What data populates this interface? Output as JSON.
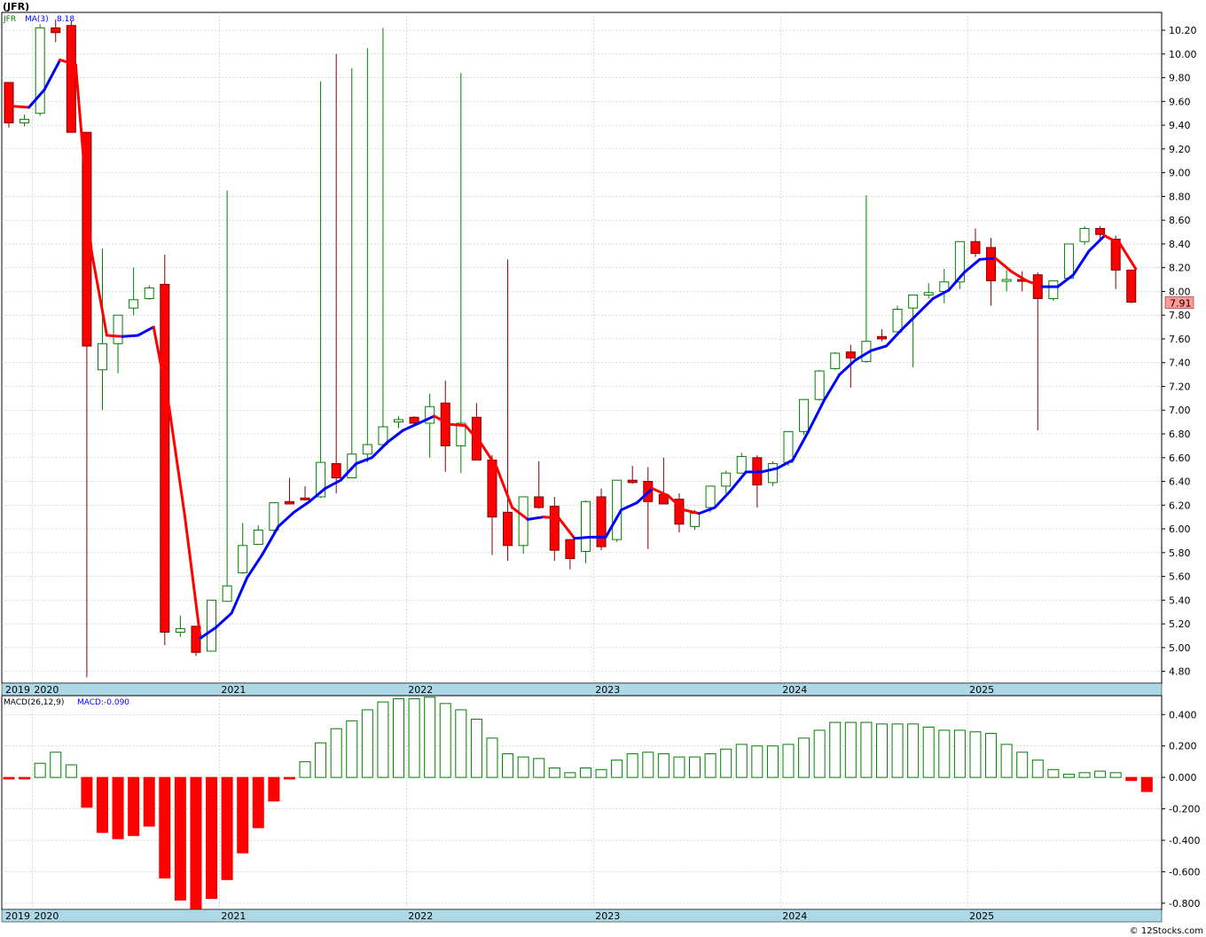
{
  "header": {
    "symbol": "(JFR)"
  },
  "footer": {
    "watermark": "© 12Stocks.com"
  },
  "colors": {
    "up": "#008000",
    "down": "#ff0000",
    "downStroke": "#800000",
    "ma_up": "#0000ff",
    "ma_down": "#ff0000",
    "grid": "#c0c0c0",
    "axisBand": "#add8e6",
    "lastPriceBg": "#ff9999"
  },
  "chart_data": [
    {
      "type": "candlestick",
      "title": "(JFR)",
      "legend": {
        "symbol": "JFR",
        "ma_label": "MA(3)",
        "ma_value": "8.18"
      },
      "frequency": "monthly",
      "start": "2019-11",
      "ylim": [
        4.7,
        10.35
      ],
      "y_ticks": [
        "10.20",
        "10.00",
        "9.80",
        "9.60",
        "9.40",
        "9.20",
        "9.00",
        "8.80",
        "8.60",
        "8.40",
        "8.20",
        "8.00",
        "7.80",
        "7.60",
        "7.40",
        "7.20",
        "7.00",
        "6.80",
        "6.60",
        "6.40",
        "6.20",
        "6.00",
        "5.80",
        "5.60",
        "5.40",
        "5.20",
        "5.00",
        "4.80"
      ],
      "x_tick_labels": [
        "2019",
        "2020",
        "2021",
        "2022",
        "2023",
        "2024",
        "2025"
      ],
      "last_price_label": "7.91",
      "grid": true,
      "ohlc": [
        [
          9.76,
          9.76,
          9.38,
          9.42
        ],
        [
          9.42,
          9.49,
          9.39,
          9.45
        ],
        [
          9.5,
          10.25,
          9.48,
          10.22
        ],
        [
          10.22,
          10.29,
          10.1,
          10.18
        ],
        [
          10.24,
          10.28,
          9.34,
          9.34
        ],
        [
          9.34,
          9.34,
          4.75,
          7.54
        ],
        [
          7.34,
          8.36,
          7.0,
          7.56
        ],
        [
          7.56,
          7.8,
          7.31,
          7.8
        ],
        [
          7.86,
          8.2,
          7.8,
          7.93
        ],
        [
          7.94,
          8.05,
          7.93,
          8.03
        ],
        [
          8.06,
          8.31,
          5.02,
          5.13
        ],
        [
          5.13,
          5.27,
          5.09,
          5.16
        ],
        [
          5.18,
          5.18,
          4.93,
          4.96
        ],
        [
          4.97,
          5.4,
          4.97,
          5.4
        ],
        [
          5.39,
          8.85,
          5.39,
          5.52
        ],
        [
          5.63,
          6.05,
          5.62,
          5.86
        ],
        [
          5.87,
          6.03,
          5.87,
          5.99
        ],
        [
          5.99,
          6.22,
          5.94,
          6.22
        ],
        [
          6.23,
          6.43,
          6.21,
          6.21
        ],
        [
          6.26,
          6.36,
          6.24,
          6.25
        ],
        [
          6.27,
          9.77,
          6.26,
          6.56
        ],
        [
          6.55,
          10.0,
          6.3,
          6.43
        ],
        [
          6.43,
          9.88,
          6.43,
          6.63
        ],
        [
          6.63,
          10.05,
          6.56,
          6.71
        ],
        [
          6.71,
          10.22,
          6.71,
          6.86
        ],
        [
          6.9,
          6.95,
          6.85,
          6.92
        ],
        [
          6.94,
          6.95,
          6.88,
          6.89
        ],
        [
          6.89,
          7.14,
          6.6,
          7.03
        ],
        [
          7.06,
          7.25,
          6.48,
          6.7
        ],
        [
          6.7,
          9.84,
          6.47,
          6.89
        ],
        [
          6.94,
          7.06,
          6.58,
          6.58
        ],
        [
          6.58,
          6.62,
          5.78,
          6.1
        ],
        [
          6.14,
          8.27,
          5.73,
          5.86
        ],
        [
          5.86,
          6.27,
          5.79,
          6.27
        ],
        [
          6.27,
          6.57,
          6.17,
          6.18
        ],
        [
          6.19,
          6.27,
          5.73,
          5.82
        ],
        [
          5.91,
          5.91,
          5.66,
          5.75
        ],
        [
          5.81,
          6.24,
          5.71,
          6.23
        ],
        [
          6.27,
          6.34,
          5.82,
          5.85
        ],
        [
          5.91,
          6.4,
          5.89,
          6.41
        ],
        [
          6.41,
          6.53,
          6.38,
          6.39
        ],
        [
          6.4,
          6.52,
          5.83,
          6.23
        ],
        [
          6.29,
          6.6,
          6.21,
          6.21
        ],
        [
          6.25,
          6.3,
          5.97,
          6.04
        ],
        [
          6.02,
          6.16,
          5.99,
          6.13
        ],
        [
          6.18,
          6.36,
          6.14,
          6.36
        ],
        [
          6.36,
          6.49,
          6.3,
          6.47
        ],
        [
          6.47,
          6.64,
          6.47,
          6.61
        ],
        [
          6.6,
          6.62,
          6.18,
          6.37
        ],
        [
          6.39,
          6.57,
          6.36,
          6.55
        ],
        [
          6.56,
          6.82,
          6.53,
          6.82
        ],
        [
          6.82,
          7.09,
          6.79,
          7.09
        ],
        [
          7.09,
          7.34,
          7.08,
          7.33
        ],
        [
          7.35,
          7.49,
          7.34,
          7.48
        ],
        [
          7.49,
          7.55,
          7.19,
          7.44
        ],
        [
          7.41,
          8.81,
          7.4,
          7.58
        ],
        [
          7.62,
          7.68,
          7.58,
          7.6
        ],
        [
          7.66,
          7.88,
          7.63,
          7.85
        ],
        [
          7.86,
          7.88,
          7.36,
          7.97
        ],
        [
          7.97,
          8.07,
          7.94,
          7.99
        ],
        [
          8.0,
          8.19,
          7.9,
          8.08
        ],
        [
          8.08,
          8.42,
          8.02,
          8.42
        ],
        [
          8.42,
          8.53,
          8.29,
          8.32
        ],
        [
          8.37,
          8.45,
          7.88,
          8.09
        ],
        [
          8.09,
          8.18,
          8.0,
          8.1
        ],
        [
          8.1,
          8.17,
          8.0,
          8.09
        ],
        [
          8.14,
          8.16,
          6.83,
          7.94
        ],
        [
          7.94,
          8.05,
          7.92,
          8.09
        ],
        [
          8.11,
          8.4,
          8.11,
          8.4
        ],
        [
          8.42,
          8.55,
          8.39,
          8.53
        ],
        [
          8.53,
          8.55,
          8.42,
          8.48
        ],
        [
          8.44,
          8.47,
          8.02,
          8.18
        ],
        [
          8.18,
          8.18,
          7.9,
          7.91
        ]
      ],
      "ma": [
        9.56,
        9.55,
        9.7,
        9.95,
        9.91,
        8.35,
        7.63,
        7.62,
        7.63,
        7.7,
        7.02,
        6.11,
        5.08,
        5.17,
        5.29,
        5.59,
        5.79,
        6.02,
        6.14,
        6.23,
        6.34,
        6.41,
        6.55,
        6.6,
        6.73,
        6.83,
        6.89,
        6.95,
        6.88,
        6.87,
        6.72,
        6.52,
        6.18,
        6.08,
        6.1,
        6.09,
        5.92,
        5.93,
        5.93,
        6.16,
        6.22,
        6.34,
        6.28,
        6.16,
        6.13,
        6.18,
        6.32,
        6.48,
        6.48,
        6.51,
        6.58,
        6.82,
        7.08,
        7.3,
        7.42,
        7.5,
        7.54,
        7.68,
        7.81,
        7.94,
        8.01,
        8.16,
        8.27,
        8.28,
        8.17,
        8.09,
        8.04,
        8.04,
        8.14,
        8.34,
        8.47,
        8.4,
        8.19
      ],
      "macd": {
        "label": "MACD(26,12,9)",
        "value_label": "MACD:-0.090",
        "ylim": [
          -0.84,
          0.52
        ],
        "y_ticks": [
          "0.400",
          "0.200",
          "0.000",
          "-0.200",
          "-0.400",
          "-0.600",
          "-0.800"
        ],
        "values": [
          -0.01,
          -0.01,
          0.09,
          0.16,
          0.08,
          -0.19,
          -0.35,
          -0.39,
          -0.37,
          -0.31,
          -0.64,
          -0.78,
          -0.84,
          -0.77,
          -0.65,
          -0.48,
          -0.32,
          -0.15,
          -0.01,
          0.1,
          0.22,
          0.31,
          0.36,
          0.43,
          0.48,
          0.5,
          0.5,
          0.51,
          0.47,
          0.43,
          0.37,
          0.25,
          0.15,
          0.13,
          0.12,
          0.06,
          0.03,
          0.06,
          0.05,
          0.11,
          0.15,
          0.16,
          0.15,
          0.13,
          0.13,
          0.15,
          0.18,
          0.21,
          0.2,
          0.2,
          0.21,
          0.25,
          0.3,
          0.35,
          0.35,
          0.35,
          0.34,
          0.34,
          0.34,
          0.32,
          0.3,
          0.3,
          0.29,
          0.28,
          0.21,
          0.16,
          0.11,
          0.05,
          0.02,
          0.03,
          0.04,
          0.03,
          -0.02,
          -0.09
        ]
      }
    }
  ]
}
